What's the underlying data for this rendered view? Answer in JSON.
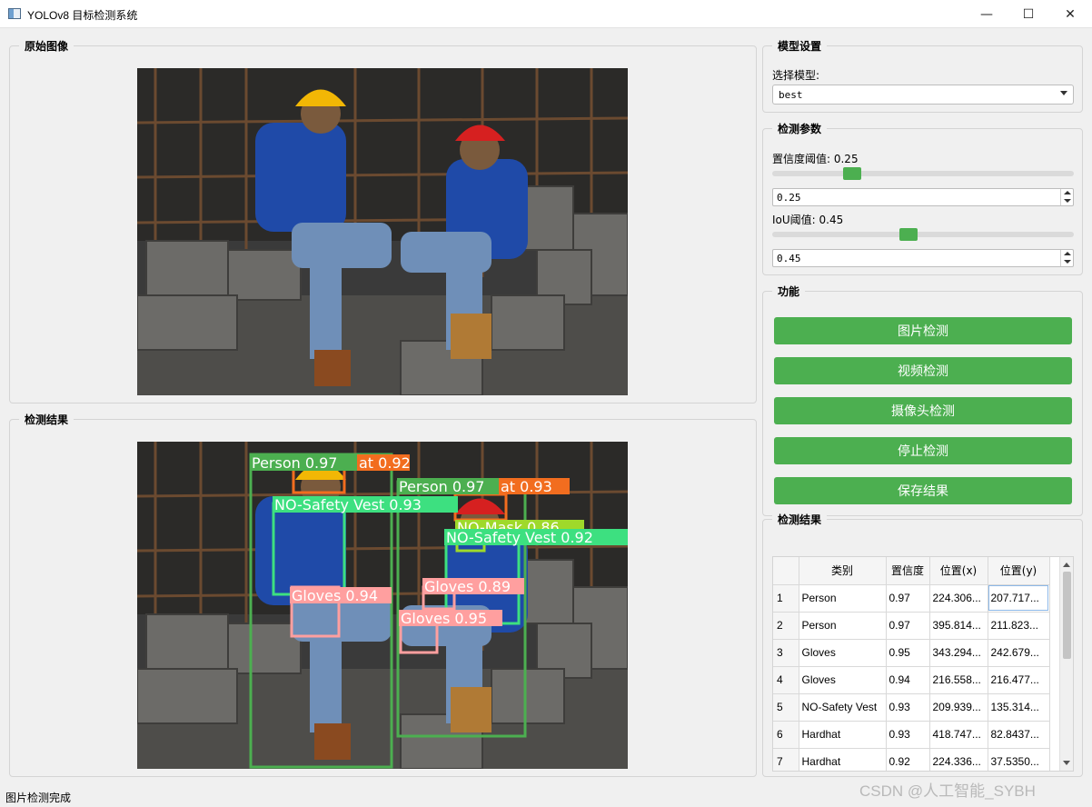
{
  "window": {
    "title": "YOLOv8 目标检测系统",
    "minimize_glyph": "—",
    "maximize_glyph": "☐",
    "close_glyph": "✕"
  },
  "original_panel": {
    "title": "原始图像"
  },
  "result_panel": {
    "title": "检测结果"
  },
  "model_settings": {
    "title": "模型设置",
    "select_label": "选择模型:",
    "selected_model": "best"
  },
  "detection_params": {
    "title": "检测参数",
    "confidence_label": "置信度阈值: 0.25",
    "confidence_value": "0.25",
    "confidence_slider": 0.25,
    "iou_label": "IoU阈值: 0.45",
    "iou_value": "0.45",
    "iou_slider": 0.45
  },
  "functions": {
    "title": "功能",
    "buttons": [
      "图片检测",
      "视频检测",
      "摄像头检测",
      "停止检测",
      "保存结果"
    ]
  },
  "results_table": {
    "title": "检测结果",
    "columns": [
      "类别",
      "置信度",
      "位置(x)",
      "位置(y)"
    ],
    "rows": [
      {
        "index": "1",
        "cls": "Person",
        "conf": "0.97",
        "x": "224.306...",
        "y": "207.717..."
      },
      {
        "index": "2",
        "cls": "Person",
        "conf": "0.97",
        "x": "395.814...",
        "y": "211.823..."
      },
      {
        "index": "3",
        "cls": "Gloves",
        "conf": "0.95",
        "x": "343.294...",
        "y": "242.679..."
      },
      {
        "index": "4",
        "cls": "Gloves",
        "conf": "0.94",
        "x": "216.558...",
        "y": "216.477..."
      },
      {
        "index": "5",
        "cls": "NO-Safety Vest",
        "conf": "0.93",
        "x": "209.939...",
        "y": "135.314..."
      },
      {
        "index": "6",
        "cls": "Hardhat",
        "conf": "0.93",
        "x": "418.747...",
        "y": "82.8437..."
      },
      {
        "index": "7",
        "cls": "Hardhat",
        "conf": "0.92",
        "x": "224.336...",
        "y": "37.5350..."
      }
    ]
  },
  "detections_overlay": [
    {
      "label": "Person 0.97",
      "color": "#4caf50"
    },
    {
      "label": "Person 0.97",
      "color": "#4caf50"
    },
    {
      "label": "NO-Safety Vest 0.93",
      "color": "#3de080"
    },
    {
      "label": "NO-Safety Vest 0.92",
      "color": "#3de080"
    },
    {
      "label": "Gloves 0.94",
      "color": "#ff9f9f"
    },
    {
      "label": "Gloves 0.95",
      "color": "#ff9f9f"
    },
    {
      "label": "Gloves 0.89",
      "color": "#ff9f9f"
    },
    {
      "label": "at 0.92",
      "color": "#f26d1f"
    },
    {
      "label": "at 0.93",
      "color": "#f26d1f"
    },
    {
      "label": "NO-Mask 0.86",
      "color": "#9fd92a"
    }
  ],
  "status_bar": {
    "text": "图片检测完成"
  },
  "watermark": "CSDN @人工智能_SYBH",
  "colors": {
    "accent": "#4caf50",
    "background": "#f0f0f0"
  }
}
